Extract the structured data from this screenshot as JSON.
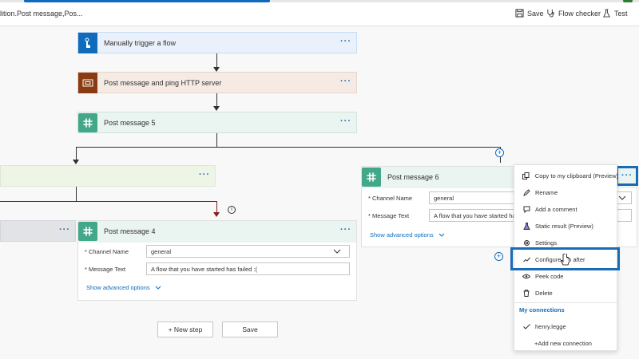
{
  "header": {
    "flow_title": "lition.Post message,Pos...",
    "save_label": "Save",
    "flow_checker_label": "Flow checker",
    "test_label": "Test"
  },
  "steps": {
    "trigger": {
      "title": "Manually trigger a flow",
      "color": "#0f6cbd"
    },
    "http": {
      "title": "Post message and ping HTTP server",
      "color": "#8a3b12"
    },
    "post5": {
      "title": "Post message 5"
    },
    "post4": {
      "title": "Post message 4",
      "channel_label": "* Channel Name",
      "channel_value": "general",
      "message_label": "* Message Text",
      "message_value": "A flow that you have started has failed :(",
      "advanced_label": "Show advanced options"
    },
    "post6": {
      "title": "Post message 6",
      "channel_label": "* Channel Name",
      "channel_value": "general",
      "message_label": "* Message Text",
      "message_value": "A flow that you have started has",
      "advanced_label": "Show advanced options"
    }
  },
  "buttons": {
    "new_step_label": "+ New step",
    "save_label": "Save"
  },
  "menu": {
    "items": [
      {
        "label": "Copy to my clipboard (Preview)",
        "icon": "copy-icon"
      },
      {
        "label": "Rename",
        "icon": "pencil-icon"
      },
      {
        "label": "Add a comment",
        "icon": "comment-icon"
      },
      {
        "label": "Static result (Preview)",
        "icon": "flask-icon"
      },
      {
        "label": "Settings",
        "icon": "gear-icon"
      },
      {
        "label": "Configure run after",
        "icon": "run-after-icon"
      },
      {
        "label": "Peek code",
        "icon": "eye-icon"
      },
      {
        "label": "Delete",
        "icon": "trash-icon"
      }
    ],
    "connections_heading": "My connections",
    "connection_name": "henry.legge",
    "add_connection_label": "+Add new connection"
  },
  "colors": {
    "accent": "#0f6cbd",
    "slack_green": "#43a889",
    "highlight": "#1a6bb8"
  }
}
